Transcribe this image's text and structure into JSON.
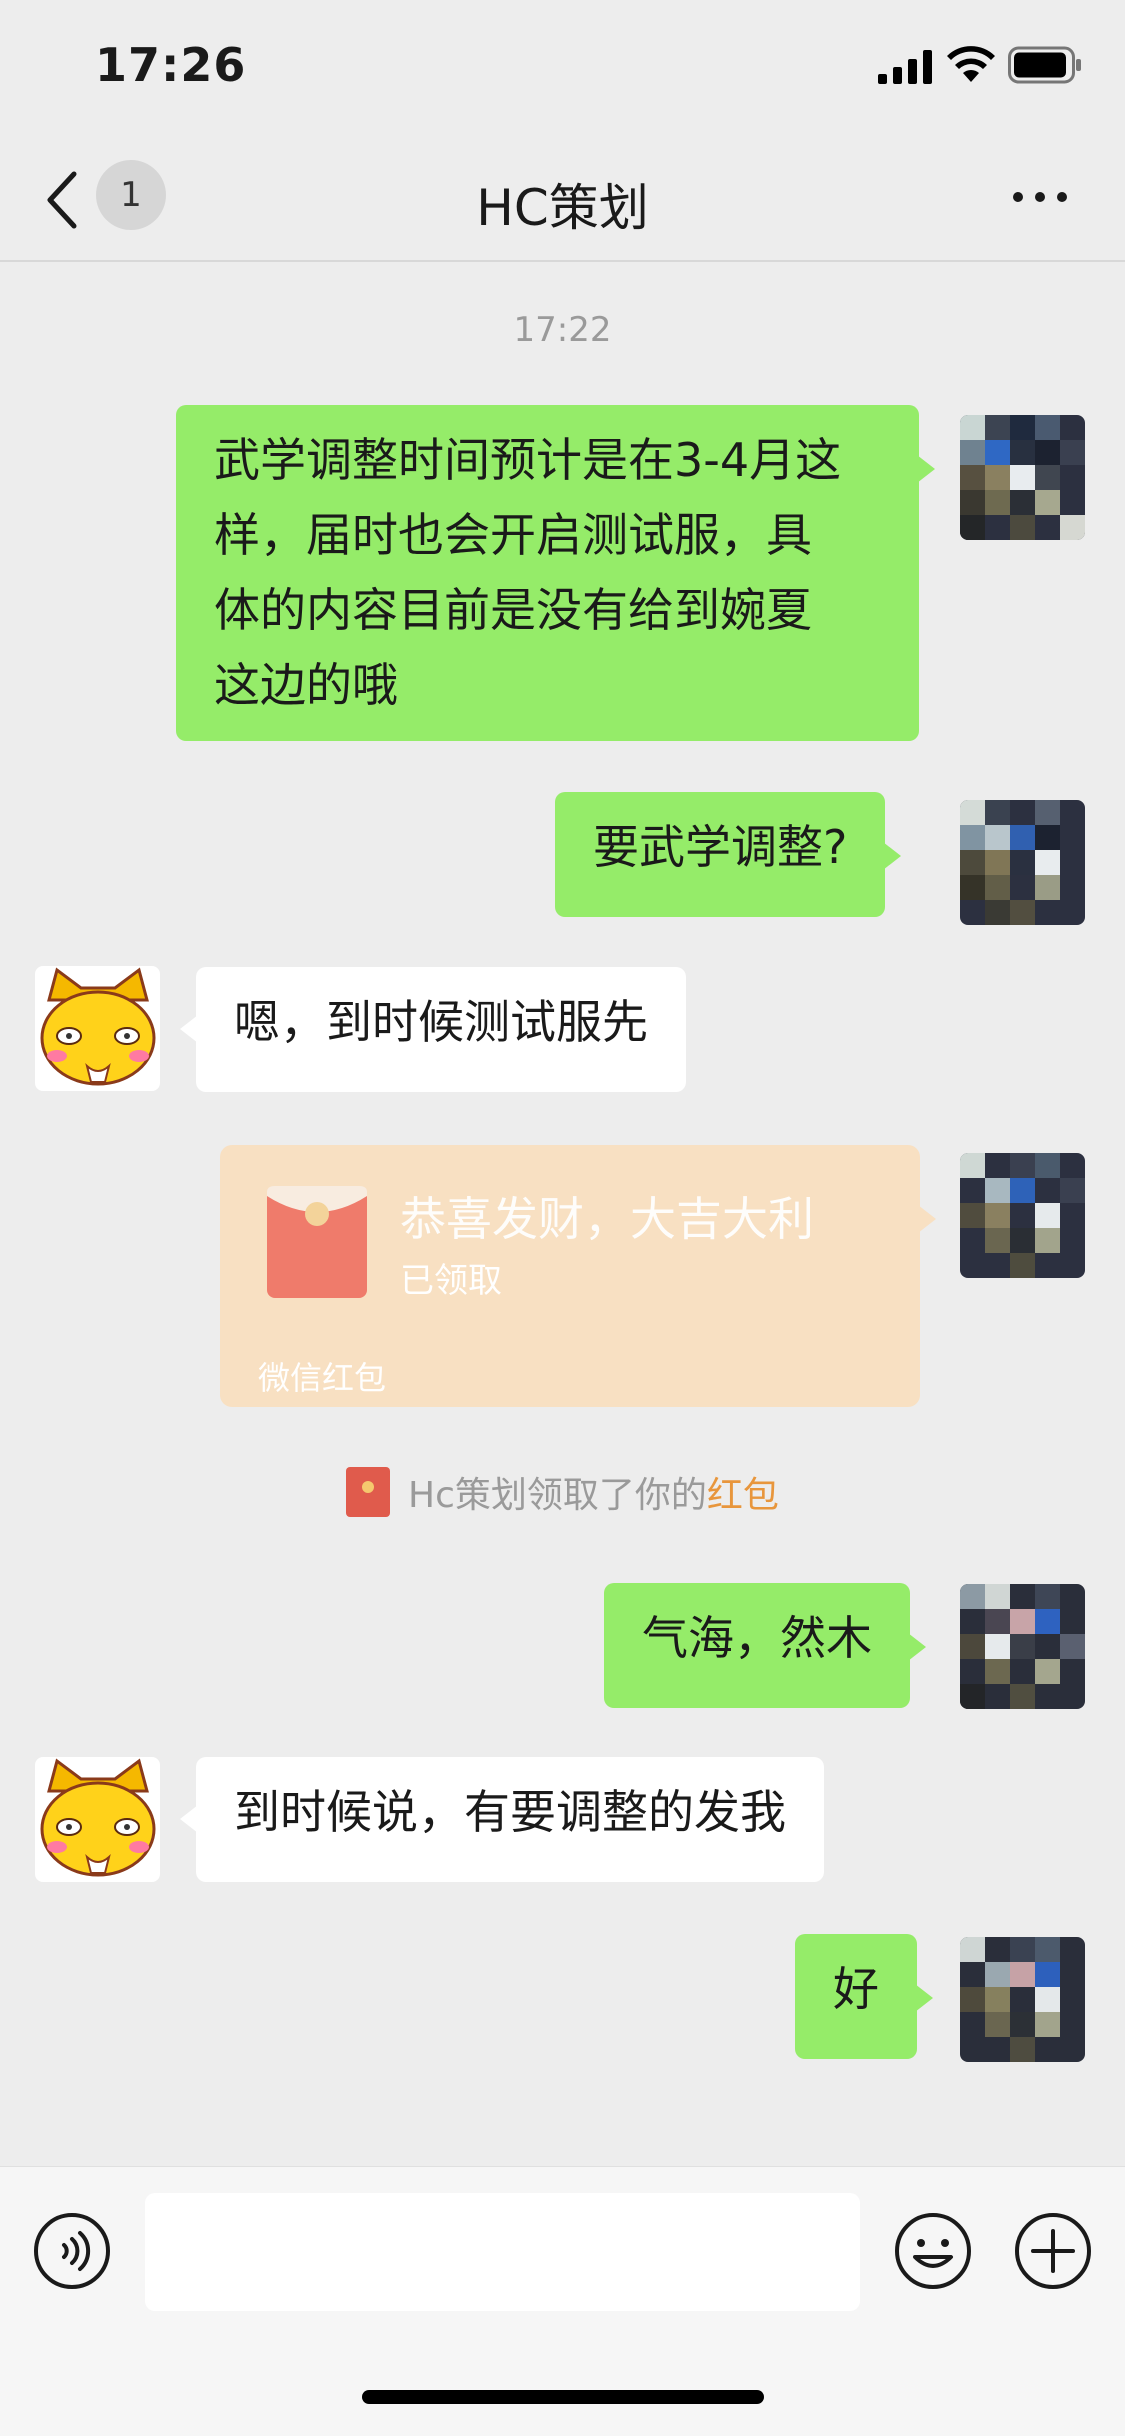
{
  "status_bar": {
    "time": "17:26"
  },
  "nav": {
    "unread_count": "1",
    "title": "HC策划"
  },
  "chat": {
    "timestamp": "17:22",
    "messages": [
      {
        "side": "self",
        "type": "text",
        "lines": [
          "武学调整时间预计是在3-4月这",
          "样，届时也会开启测试服，具",
          "体的内容目前是没有给到婉夏",
          "这边的哦"
        ]
      },
      {
        "side": "self",
        "type": "text",
        "text": "要武学调整?"
      },
      {
        "side": "other",
        "type": "text",
        "text": "嗯，到时候测试服先"
      },
      {
        "side": "self",
        "type": "red_packet",
        "title": "恭喜发财，大吉大利",
        "status": "已领取",
        "footer": "微信红包"
      },
      {
        "side": "self",
        "type": "text",
        "text": "气海，然木"
      },
      {
        "side": "other",
        "type": "text",
        "text": "到时候说，有要调整的发我"
      },
      {
        "side": "self",
        "type": "text",
        "text": "好"
      }
    ],
    "system_notice": {
      "prefix": "Hc策划领取了你的",
      "link": "红包"
    }
  },
  "colors": {
    "self_bubble": "#95ec69",
    "other_bubble": "#ffffff",
    "background": "#ededed",
    "red_packet": "#f8e0c2",
    "notice_link": "#e8963c"
  },
  "icons": [
    "back-icon",
    "more-icon",
    "voice-icon",
    "emoji-icon",
    "plus-icon",
    "red-packet-icon",
    "signal-icon",
    "wifi-icon",
    "battery-icon"
  ]
}
